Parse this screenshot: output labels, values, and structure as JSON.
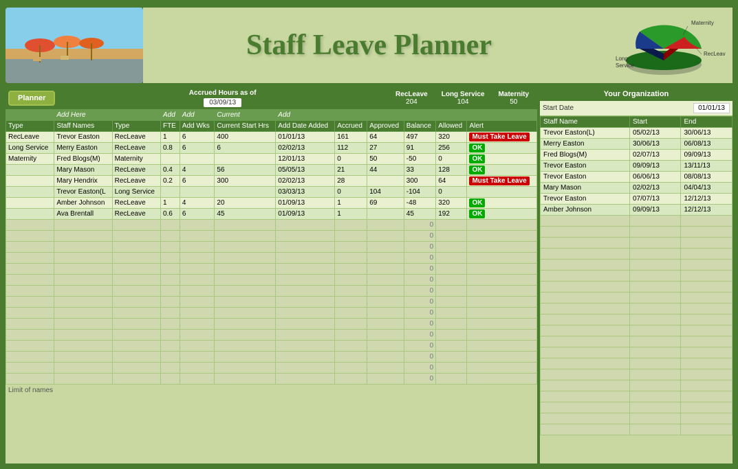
{
  "header": {
    "title": "Staff Leave Planner",
    "accrued_label": "Accrued Hours as of",
    "accrued_date": "03/09/13",
    "planner_btn": "Planner",
    "summary": {
      "recleave_label": "RecLeave",
      "recleave_value": "204",
      "longservice_label": "Long Service",
      "longservice_value": "104",
      "maternity_label": "Maternity",
      "maternity_value": "50"
    }
  },
  "chart": {
    "labels": [
      "Maternity",
      "Long Service",
      "RecLeave"
    ],
    "colors": [
      "#cc0000",
      "#1a3a6a",
      "#2a8a2a"
    ],
    "values": [
      50,
      104,
      204
    ]
  },
  "planner": {
    "columns": {
      "type": "Type",
      "staff_names": "Staff Names",
      "type2": "Type",
      "fte": "FTE",
      "add_wks": "Add Wks",
      "current_start_hrs": "Current Start Hrs",
      "add_date": "Add Date Added",
      "accrued": "Accrued",
      "approved": "Approved",
      "balance": "Balance",
      "allowed": "Allowed",
      "alert": "Alert"
    },
    "add_headers": {
      "add_here": "Add Here",
      "add_fte": "Add",
      "add_wks": "Add",
      "add_date": "Add"
    },
    "rows": [
      {
        "type": "RecLeave",
        "name": "Trevor Easton",
        "type2": "RecLeave",
        "fte": "1",
        "wks": "6",
        "start_hrs": "400",
        "date_added": "01/01/13",
        "accrued": "161",
        "approved": "64",
        "balance": "497",
        "allowed": "320",
        "alert": "Must Take Leave",
        "alert_class": "must-take"
      },
      {
        "type": "Long Service",
        "name": "Merry Easton",
        "type2": "RecLeave",
        "fte": "0.8",
        "wks": "6",
        "start_hrs": "6",
        "date_added": "02/02/13",
        "accrued": "112",
        "approved": "27",
        "balance": "91",
        "allowed": "256",
        "alert": "OK",
        "alert_class": "ok"
      },
      {
        "type": "Maternity",
        "name": "Fred Blogs(M)",
        "type2": "Maternity",
        "fte": "",
        "wks": "",
        "start_hrs": "",
        "date_added": "12/01/13",
        "accrued": "0",
        "approved": "50",
        "balance": "-50",
        "allowed": "0",
        "alert": "OK",
        "alert_class": "ok"
      },
      {
        "type": "",
        "name": "Mary Mason",
        "type2": "RecLeave",
        "fte": "0.4",
        "wks": "4",
        "start_hrs": "56",
        "date_added": "05/05/13",
        "accrued": "21",
        "approved": "44",
        "balance": "33",
        "allowed": "128",
        "alert": "OK",
        "alert_class": "ok"
      },
      {
        "type": "",
        "name": "Mary Hendrix",
        "type2": "RecLeave",
        "fte": "0.2",
        "wks": "6",
        "start_hrs": "300",
        "date_added": "02/02/13",
        "accrued": "28",
        "approved": "",
        "balance": "300",
        "allowed": "64",
        "alert": "Must Take Leave",
        "alert_class": "must-take"
      },
      {
        "type": "",
        "name": "Trevor Easton(L",
        "type2": "Long Service",
        "fte": "",
        "wks": "",
        "start_hrs": "",
        "date_added": "03/03/13",
        "accrued": "0",
        "approved": "104",
        "balance": "-104",
        "allowed": "0",
        "alert": "",
        "alert_class": "none"
      },
      {
        "type": "",
        "name": "Amber Johnson",
        "type2": "RecLeave",
        "fte": "1",
        "wks": "4",
        "start_hrs": "20",
        "date_added": "01/09/13",
        "accrued": "1",
        "approved": "69",
        "balance": "-48",
        "allowed": "320",
        "alert": "OK",
        "alert_class": "ok"
      },
      {
        "type": "",
        "name": "Ava Brentall",
        "type2": "RecLeave",
        "fte": "0.6",
        "wks": "6",
        "start_hrs": "45",
        "date_added": "01/09/13",
        "accrued": "1",
        "approved": "",
        "balance": "45",
        "allowed": "192",
        "alert": "OK",
        "alert_class": "ok"
      }
    ],
    "limit_text": "Limit of names",
    "empty_value": "0"
  },
  "organization": {
    "header": "Your Organization",
    "start_date_label": "Start Date",
    "start_date_value": "01/01/13",
    "columns": {
      "staff_name": "Staff Name",
      "start": "Start",
      "end": "End"
    },
    "rows": [
      {
        "name": "Trevor Easton(L)",
        "start": "05/02/13",
        "end": "30/06/13"
      },
      {
        "name": "Merry Easton",
        "start": "30/06/13",
        "end": "06/08/13"
      },
      {
        "name": "Fred Blogs(M)",
        "start": "02/07/13",
        "end": "09/09/13"
      },
      {
        "name": "Trevor Easton",
        "start": "09/09/13",
        "end": "13/11/13"
      },
      {
        "name": "Trevor Easton",
        "start": "06/06/13",
        "end": "08/08/13"
      },
      {
        "name": "Mary Mason",
        "start": "02/02/13",
        "end": "04/04/13"
      },
      {
        "name": "Trevor Easton",
        "start": "07/07/13",
        "end": "12/12/13"
      },
      {
        "name": "Amber Johnson",
        "start": "09/09/13",
        "end": "12/12/13"
      }
    ]
  }
}
